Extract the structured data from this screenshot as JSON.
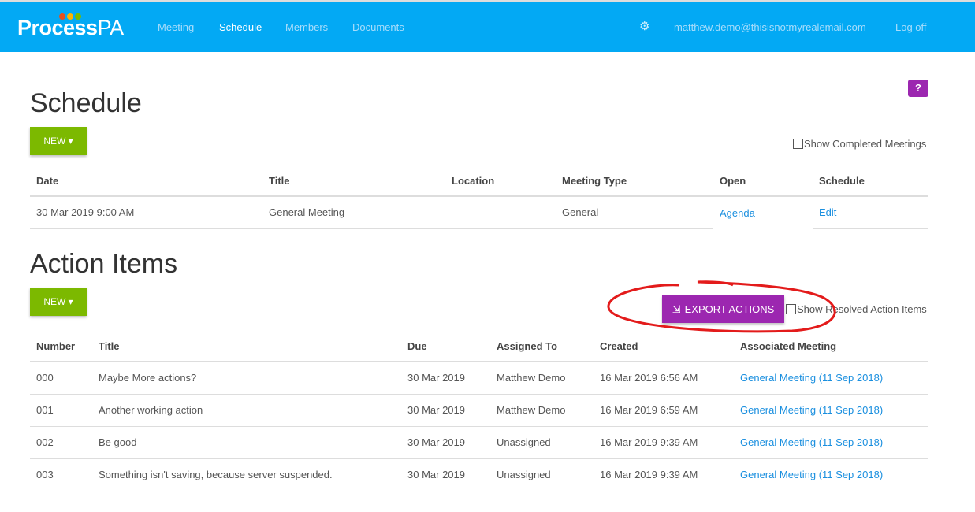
{
  "nav": {
    "brand": "Process",
    "brand_suffix": "PA",
    "items": [
      "Meeting",
      "Schedule",
      "Members",
      "Documents"
    ],
    "active": "Schedule",
    "user": "matthew.demo@thisisnotmyrealemail.com",
    "logoff": "Log off",
    "settings_icon": "gear-icon"
  },
  "colors": {
    "nav": "#03a9f4",
    "new": "#7cb900",
    "export": "#9c27b0",
    "annotation": "#e31b1b"
  },
  "help": "?",
  "schedule": {
    "title": "Schedule",
    "new_label": "NEW",
    "show_completed": "Show Completed Meetings",
    "columns": [
      "Date",
      "Title",
      "Location",
      "Meeting Type",
      "Open",
      "Schedule"
    ],
    "rows": [
      {
        "date": "30 Mar 2019 9:00 AM",
        "title": "General Meeting",
        "location": "",
        "type": "General",
        "open": "Agenda",
        "schedule": "Edit"
      }
    ]
  },
  "actions": {
    "title": "Action Items",
    "new_label": "NEW",
    "export_label": "EXPORT ACTIONS",
    "show_resolved": "Show Resolved Action Items",
    "columns": [
      "Number",
      "Title",
      "Due",
      "Assigned To",
      "Created",
      "Associated Meeting"
    ],
    "rows": [
      {
        "number": "000",
        "title": "Maybe More actions?",
        "due": "30 Mar 2019",
        "assigned": "Matthew Demo",
        "created": "16 Mar 2019 6:56 AM",
        "meeting": "General Meeting (11 Sep 2018)"
      },
      {
        "number": "001",
        "title": "Another working action",
        "due": "30 Mar 2019",
        "assigned": "Matthew Demo",
        "created": "16 Mar 2019 6:59 AM",
        "meeting": "General Meeting (11 Sep 2018)"
      },
      {
        "number": "002",
        "title": "Be good",
        "due": "30 Mar 2019",
        "assigned": "Unassigned",
        "created": "16 Mar 2019 9:39 AM",
        "meeting": "General Meeting (11 Sep 2018)"
      },
      {
        "number": "003",
        "title": "Something isn't saving, because server suspended.",
        "due": "30 Mar 2019",
        "assigned": "Unassigned",
        "created": "16 Mar 2019 9:39 AM",
        "meeting": "General Meeting (11 Sep 2018)"
      }
    ]
  }
}
